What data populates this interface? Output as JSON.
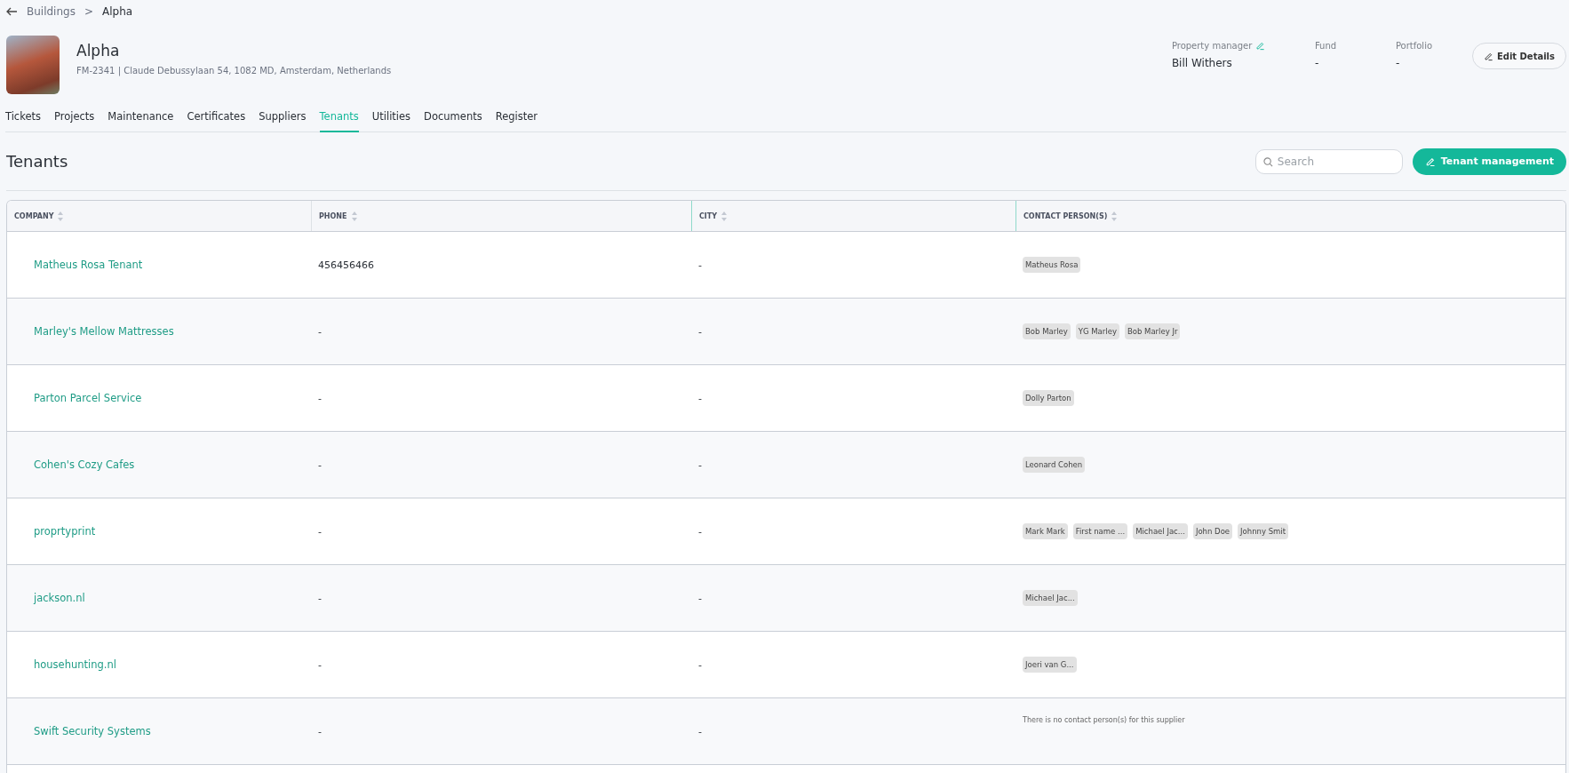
{
  "breadcrumb": {
    "parent": "Buildings",
    "separator": ">",
    "current": "Alpha"
  },
  "building": {
    "name": "Alpha",
    "code": "FM-2341",
    "divider": "|",
    "address": "Claude Debussylaan 54, 1082 MD, Amsterdam, Netherlands"
  },
  "details": [
    {
      "label": "Property manager",
      "value": "Bill Withers",
      "editable": true
    },
    {
      "label": "Fund",
      "value": "-",
      "editable": false
    },
    {
      "label": "Portfolio",
      "value": "-",
      "editable": false
    }
  ],
  "edit_button": "Edit Details",
  "tabs": [
    {
      "label": "Tickets",
      "selected": false
    },
    {
      "label": "Projects",
      "selected": false
    },
    {
      "label": "Maintenance",
      "selected": false
    },
    {
      "label": "Certificates",
      "selected": false
    },
    {
      "label": "Suppliers",
      "selected": false
    },
    {
      "label": "Tenants",
      "selected": true
    },
    {
      "label": "Utilities",
      "selected": false
    },
    {
      "label": "Documents",
      "selected": false
    },
    {
      "label": "Register",
      "selected": false
    }
  ],
  "section": {
    "title": "Tenants",
    "search": {
      "placeholder": "Search"
    },
    "action_button": "Tenant management"
  },
  "table": {
    "columns": [
      "COMPANY",
      "PHONE",
      "CITY",
      "CONTACT PERSON(S)"
    ],
    "rows": [
      {
        "company": "Matheus Rosa Tenant",
        "phone": "456456466",
        "city": "-",
        "contacts": [
          "Matheus Rosa"
        ]
      },
      {
        "company": "Marley's Mellow Mattresses",
        "phone": "-",
        "city": "-",
        "contacts": [
          "Bob Marley",
          "YG Marley",
          "Bob Marley Jr"
        ]
      },
      {
        "company": "Parton Parcel Service",
        "phone": "-",
        "city": "-",
        "contacts": [
          "Dolly Parton"
        ]
      },
      {
        "company": "Cohen's Cozy Cafes",
        "phone": "-",
        "city": "-",
        "contacts": [
          "Leonard Cohen"
        ]
      },
      {
        "company": "proprtyprint",
        "phone": "-",
        "city": "-",
        "contacts": [
          "Mark Mark",
          "First name ...",
          "Michael Jac...",
          "John Doe",
          "Johnny Smit"
        ]
      },
      {
        "company": "jackson.nl",
        "phone": "-",
        "city": "-",
        "contacts": [
          "Michael Jac..."
        ]
      },
      {
        "company": "househunting.nl",
        "phone": "-",
        "city": "-",
        "contacts": [
          "Joeri van G..."
        ]
      },
      {
        "company": "Swift Security Systems",
        "phone": "-",
        "city": "-",
        "note": "There is no contact person(s) for this supplier"
      }
    ]
  }
}
